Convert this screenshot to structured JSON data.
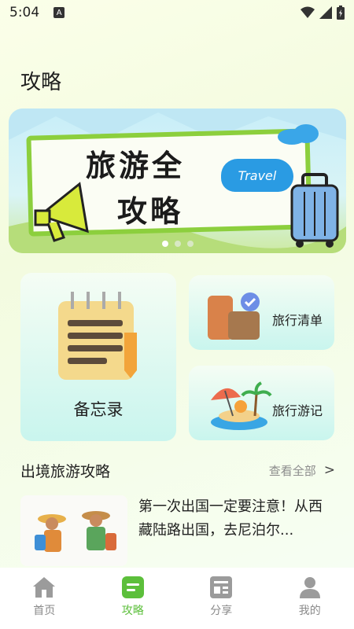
{
  "status": {
    "time": "5:04",
    "a_badge": "A"
  },
  "page_title": "攻略",
  "banner": {
    "title_line1": "旅游全",
    "title_line2": "攻略",
    "cloud_text": "Travel",
    "dots": 3,
    "active_dot": 0
  },
  "cards": {
    "memo": "备忘录",
    "list": "旅行清单",
    "journal": "旅行游记"
  },
  "section": {
    "title": "出境旅游攻略",
    "view_all": "查看全部",
    "view_all_arrow": ">"
  },
  "article": {
    "title": "第一次出国一定要注意！从西藏陆路出国，去尼泊尔..."
  },
  "tabs": [
    {
      "label": "首页",
      "icon": "home-icon"
    },
    {
      "label": "攻略",
      "icon": "guide-icon"
    },
    {
      "label": "分享",
      "icon": "share-icon"
    },
    {
      "label": "我的",
      "icon": "user-icon"
    }
  ],
  "colors": {
    "accent": "#5cbf3b",
    "inactive": "#9b9b9b"
  }
}
